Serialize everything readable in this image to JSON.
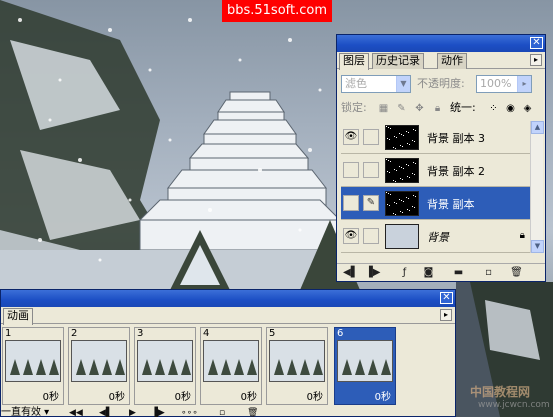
{
  "watermark_text": "bbs.51soft.com",
  "layers_panel": {
    "tabs": [
      "图层",
      "历史记录",
      "动作"
    ],
    "blend_mode": "滤色",
    "opacity_label": "不透明度:",
    "opacity_value": "100%",
    "lock_label": "锁定:",
    "unify_label": "统一:",
    "layers": [
      {
        "name": "背景 副本 3",
        "visible": true,
        "selected": false
      },
      {
        "name": "背景 副本 2",
        "visible": false,
        "selected": false
      },
      {
        "name": "背景 副本",
        "visible": false,
        "selected": true
      },
      {
        "name": "背景",
        "visible": true,
        "selected": false,
        "locked": true
      }
    ]
  },
  "animation_panel": {
    "title": "动画",
    "frames": [
      {
        "number": "1",
        "delay": "0秒"
      },
      {
        "number": "2",
        "delay": "0秒"
      },
      {
        "number": "3",
        "delay": "0秒"
      },
      {
        "number": "4",
        "delay": "0秒"
      },
      {
        "number": "5",
        "delay": "0秒"
      },
      {
        "number": "6",
        "delay": "0秒"
      }
    ],
    "loop_option": "一直有效"
  },
  "site_logo": {
    "text": "中国教程网",
    "url": "www.jcwcn.com"
  },
  "colors": {
    "selection": "#2d5db8",
    "titlebar": "#1c4ec4",
    "panel_bg": "#ece9d8",
    "watermark_bg": "#ff0000"
  }
}
